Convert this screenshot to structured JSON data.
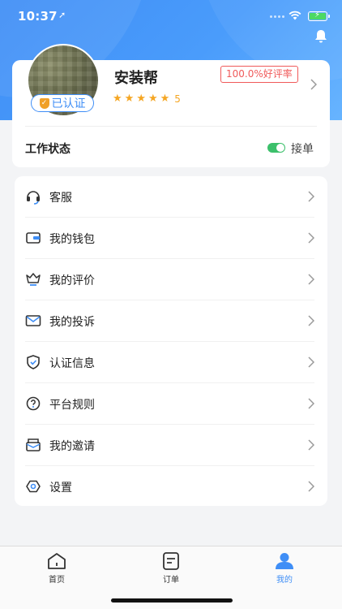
{
  "status_bar": {
    "time": "10:37",
    "location_glyph": "➚"
  },
  "profile": {
    "name": "安装帮",
    "verified_label": "已认证",
    "rating_badge": "100.0%好评率",
    "stars": 5,
    "score": "5",
    "work_status_label": "工作状态",
    "work_status_value": "接单",
    "work_status_on": true
  },
  "menu": {
    "items": [
      {
        "label": "客服",
        "icon": "headset-icon"
      },
      {
        "label": "我的钱包",
        "icon": "wallet-icon"
      },
      {
        "label": "我的评价",
        "icon": "review-icon"
      },
      {
        "label": "我的投诉",
        "icon": "mail-icon"
      },
      {
        "label": "认证信息",
        "icon": "shield-check-icon"
      },
      {
        "label": "平台规则",
        "icon": "question-icon"
      },
      {
        "label": "我的邀请",
        "icon": "invite-icon"
      },
      {
        "label": "设置",
        "icon": "settings-icon"
      }
    ]
  },
  "tabs": [
    {
      "label": "首页",
      "icon": "home-icon",
      "active": false
    },
    {
      "label": "订单",
      "icon": "order-icon",
      "active": false
    },
    {
      "label": "我的",
      "icon": "user-icon",
      "active": true
    }
  ],
  "colors": {
    "accent": "#3f8ef6",
    "star": "#f5a623",
    "rating_red": "#f05a5a",
    "toggle_on": "#3cc06b"
  }
}
